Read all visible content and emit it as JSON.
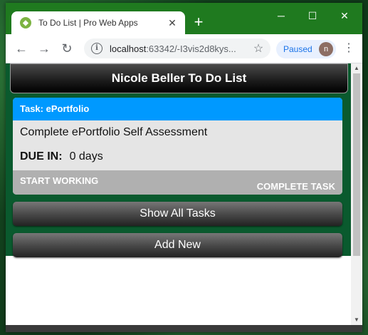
{
  "browser": {
    "tab_title": "To Do List | Pro Web Apps",
    "tab_favicon_letter": "◆",
    "close_symbol": "✕",
    "new_tab_symbol": "+",
    "minimize_symbol": "─",
    "maximize_symbol": "☐",
    "window_close_symbol": "✕",
    "back_symbol": "←",
    "forward_symbol": "→",
    "reload_symbol": "↻",
    "info_symbol": "i",
    "url_host": "localhost",
    "url_rest": ":63342/-I3vis2d8kys...",
    "star_symbol": "☆",
    "profile_status": "Paused",
    "avatar_letter": "n",
    "menu_symbol": "⋮"
  },
  "app": {
    "header_title": "Nicole Beller To Do List",
    "task": {
      "heading": "Task: ePortfolio",
      "description": "Complete ePortfolio Self Assessment",
      "due_label": "DUE IN:",
      "due_value": "0 days",
      "start_label": "START WORKING",
      "complete_label": "COMPLETE TASK"
    },
    "show_all_label": "Show All Tasks",
    "add_new_label": "Add New"
  },
  "colors": {
    "titlebar": "#1f7a1f",
    "app_background": "#0a5a2e",
    "task_header": "#0099ff",
    "task_body": "#e5e5e5",
    "task_footer": "#b0b0b0"
  },
  "icons": {
    "favicon": "app-favicon-icon",
    "info": "info-icon",
    "star": "bookmark-star-icon",
    "menu": "kebab-menu-icon"
  }
}
